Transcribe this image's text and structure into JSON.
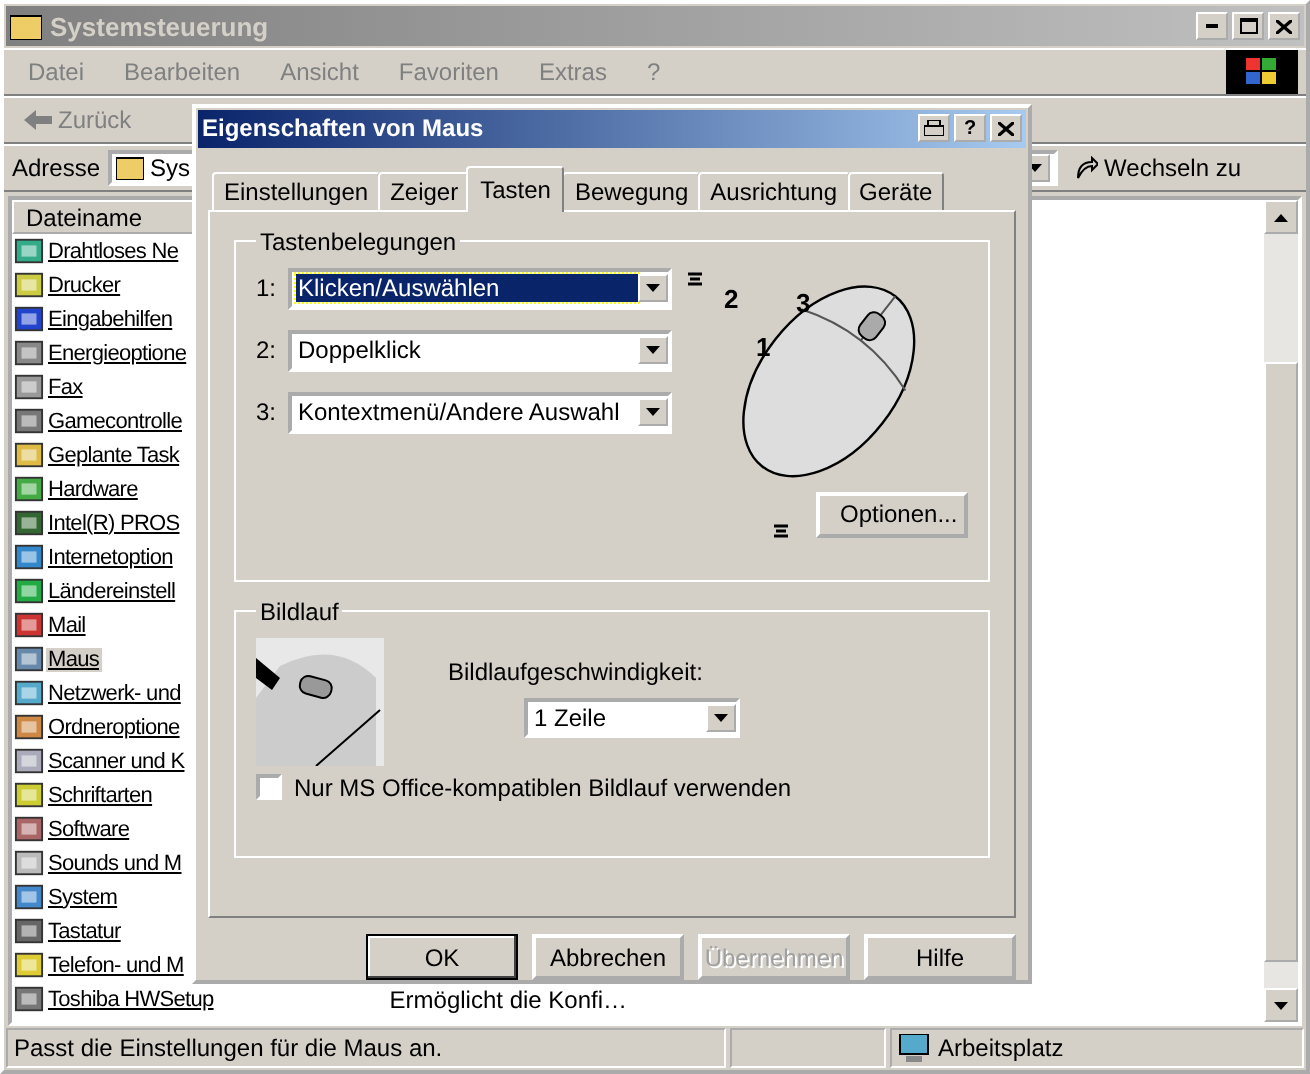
{
  "window": {
    "title": "Systemsteuerung"
  },
  "menu": [
    "Datei",
    "Bearbeiten",
    "Ansicht",
    "Favoriten",
    "Extras",
    "?"
  ],
  "toolbar": {
    "back": "Zurück"
  },
  "address": {
    "label": "Adresse",
    "value": "Sys",
    "go": "Wechseln zu"
  },
  "list": {
    "columns": [
      "Dateiname"
    ],
    "rows": [
      {
        "name": "Drahtloses Ne",
        "selected": false
      },
      {
        "name": "Drucker",
        "selected": false
      },
      {
        "name": "Eingabehilfen",
        "selected": false
      },
      {
        "name": "Energieoptione",
        "selected": false
      },
      {
        "name": "Fax",
        "selected": false
      },
      {
        "name": "Gamecontrolle",
        "selected": false
      },
      {
        "name": "Geplante Task",
        "selected": false
      },
      {
        "name": "Hardware",
        "selected": false
      },
      {
        "name": "Intel(R) PROS",
        "selected": false
      },
      {
        "name": "Internetoption",
        "selected": false
      },
      {
        "name": "Ländereinstell",
        "selected": false
      },
      {
        "name": "Mail",
        "selected": false
      },
      {
        "name": "Maus",
        "selected": true
      },
      {
        "name": "Netzwerk- und",
        "selected": false
      },
      {
        "name": "Ordneroptione",
        "selected": false
      },
      {
        "name": "Scanner und K",
        "selected": false
      },
      {
        "name": "Schriftarten",
        "selected": false
      },
      {
        "name": "Software",
        "selected": false
      },
      {
        "name": "Sounds und M",
        "selected": false
      },
      {
        "name": "System",
        "selected": false
      },
      {
        "name": "Tastatur",
        "selected": false
      },
      {
        "name": "Telefon- und M",
        "selected": false
      },
      {
        "name": "Toshiba HWSetup",
        "description": "Ermöglicht die Konfi…",
        "selected": false
      }
    ]
  },
  "status_bar": {
    "text": "Passt die Einstellungen für die Maus an.",
    "location": "Arbeitsplatz"
  },
  "dialog": {
    "title": "Eigenschaften von Maus",
    "help_glyph": "?",
    "tabs": [
      {
        "label": "Einstellungen",
        "selected": false
      },
      {
        "label": "Zeiger",
        "selected": false
      },
      {
        "label": "Tasten",
        "selected": true
      },
      {
        "label": "Bewegung",
        "selected": false
      },
      {
        "label": "Ausrichtung",
        "selected": false
      },
      {
        "label": "Geräte",
        "selected": false
      }
    ],
    "button_group": {
      "title": "Tastenbelegungen",
      "rows": [
        {
          "label": "1:",
          "value": "Klicken/Auswählen",
          "focused": true
        },
        {
          "label": "2:",
          "value": "Doppelklick",
          "focused": false
        },
        {
          "label": "3:",
          "value": "Kontextmenü/Andere Auswahl",
          "focused": false
        }
      ]
    },
    "mouse_labels": [
      "2",
      "3",
      "1"
    ],
    "options_button": "Optionen...",
    "scroll_group": {
      "title": "Bildlauf",
      "speed_label": "Bildlaufgeschwindigkeit:",
      "speed": "1 Zeile",
      "checkbox": {
        "label": "Nur MS Office-kompatiblen Bildlauf verwenden",
        "checked": false
      }
    },
    "buttons": [
      {
        "label": "OK",
        "default": true,
        "disabled": false
      },
      {
        "label": "Abbrechen",
        "default": false,
        "disabled": false
      },
      {
        "label": "Übernehmen",
        "default": false,
        "disabled": true
      },
      {
        "label": "Hilfe",
        "default": false,
        "disabled": false
      }
    ]
  }
}
